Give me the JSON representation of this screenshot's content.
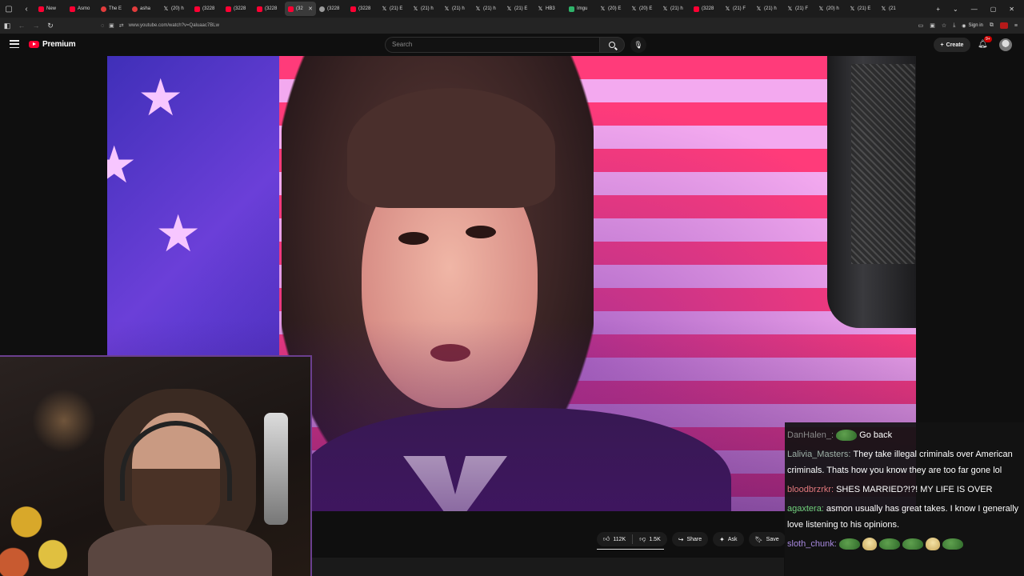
{
  "browser": {
    "tabs": [
      {
        "label": "New",
        "icon": "youtube-icon",
        "active": false
      },
      {
        "label": "Asmo",
        "icon": "youtube-icon",
        "active": false
      },
      {
        "label": "The E",
        "icon": "red-dot-icon",
        "active": false
      },
      {
        "label": "asha",
        "icon": "red-dot-icon",
        "active": false
      },
      {
        "label": "(20) h",
        "icon": "x-icon",
        "active": false
      },
      {
        "label": "(3228",
        "icon": "youtube-icon",
        "active": false
      },
      {
        "label": "(3228",
        "icon": "youtube-icon",
        "active": false
      },
      {
        "label": "(3228",
        "icon": "youtube-icon",
        "active": false
      },
      {
        "label": "(32",
        "icon": "youtube-icon",
        "active": true
      },
      {
        "label": "(3228",
        "icon": "gray-dot-icon",
        "active": false
      },
      {
        "label": "(3228",
        "icon": "youtube-icon",
        "active": false
      },
      {
        "label": "(21) E",
        "icon": "x-icon",
        "active": false
      },
      {
        "label": "(21) h",
        "icon": "x-icon",
        "active": false
      },
      {
        "label": "(21) h",
        "icon": "x-icon",
        "active": false
      },
      {
        "label": "(21) h",
        "icon": "x-icon",
        "active": false
      },
      {
        "label": "(21) E",
        "icon": "x-icon",
        "active": false
      },
      {
        "label": "HB3",
        "icon": "x-icon",
        "active": false
      },
      {
        "label": "Imgu",
        "icon": "green-square-icon",
        "active": false
      },
      {
        "label": "(20) E",
        "icon": "x-icon",
        "active": false
      },
      {
        "label": "(20) E",
        "icon": "x-icon",
        "active": false
      },
      {
        "label": "(21) h",
        "icon": "x-icon",
        "active": false
      },
      {
        "label": "(3228",
        "icon": "youtube-icon",
        "active": false
      },
      {
        "label": "(21) F",
        "icon": "x-icon",
        "active": false
      },
      {
        "label": "(21) h",
        "icon": "x-icon",
        "active": false
      },
      {
        "label": "(21) F",
        "icon": "x-icon",
        "active": false
      },
      {
        "label": "(20) h",
        "icon": "x-icon",
        "active": false
      },
      {
        "label": "(21) E",
        "icon": "x-icon",
        "active": false
      },
      {
        "label": "(21",
        "icon": "x-icon",
        "active": false
      }
    ],
    "url": "www.youtube.com/watch?v=Qaluaac7BLw",
    "signin_label": "Sign in"
  },
  "masthead": {
    "logo_text": "Premium",
    "search_placeholder": "Search",
    "create_label": "Create",
    "notification_count": "9+"
  },
  "actions": {
    "likes": "112K",
    "dislikes": "1.5K",
    "share_label": "Share",
    "ask_label": "Ask",
    "save_label": "Save"
  },
  "chat": {
    "messages": [
      {
        "user": "DanHalen_:",
        "user_color": "#8a8a8a",
        "emote": "frog",
        "text": "Go back"
      },
      {
        "user": "Lalivia_Masters:",
        "user_color": "#9fb1a8",
        "emote": "",
        "text": "They take illegal criminals over American criminals. Thats how you know they are too far gone lol"
      },
      {
        "user": "bloodbrzrkr:",
        "user_color": "#e0787c",
        "emote": "",
        "text": "SHES MARRIED?!?! MY LIFE IS OVER"
      },
      {
        "user": "agaxtera:",
        "user_color": "#6fcf7a",
        "emote": "",
        "text": "asmon usually has great takes. I know I generally love listening to his opinions."
      },
      {
        "user": "sloth_chunk:",
        "user_color": "#a889e0",
        "emote": "frog-row",
        "text": ""
      }
    ]
  }
}
